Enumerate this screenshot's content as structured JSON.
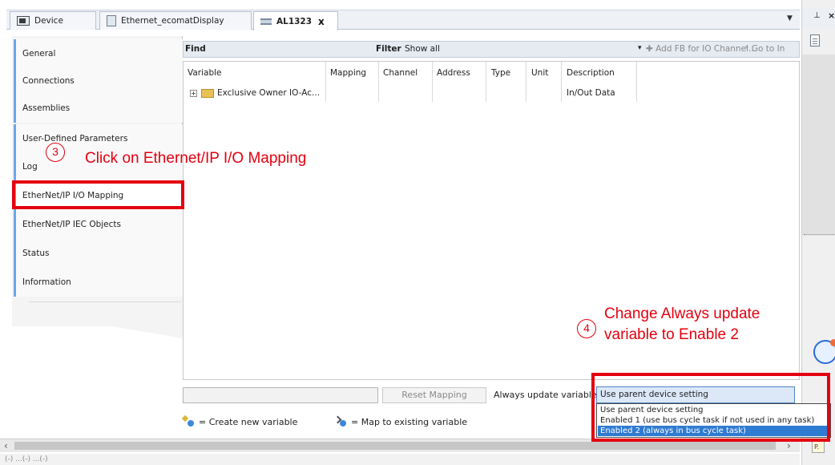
{
  "tabs": [
    {
      "label": "Device",
      "icon": "device-icon"
    },
    {
      "label": "Ethernet_ecomatDisplay",
      "icon": "ethernet-device-icon"
    },
    {
      "label": "AL1323",
      "icon": "module-icon",
      "close": "x"
    }
  ],
  "nav": {
    "items": [
      {
        "label": "General"
      },
      {
        "label": "Connections"
      },
      {
        "label": "Assemblies"
      },
      {
        "label": "User-Defined Parameters"
      },
      {
        "label": "Log"
      },
      {
        "label": "EtherNet/IP I/O Mapping"
      },
      {
        "label": "EtherNet/IP IEC Objects"
      },
      {
        "label": "Status"
      },
      {
        "label": "Information"
      }
    ]
  },
  "findbar": {
    "find_label": "Find",
    "filter_label": "Filter",
    "filter_value": "Show all",
    "add_fb": "Add FB for IO Channel...",
    "goto": "Go to In"
  },
  "table": {
    "headers": [
      "Variable",
      "Mapping",
      "Channel",
      "Address",
      "Type",
      "Unit",
      "Description"
    ],
    "rows": [
      {
        "variable": "Exclusive Owner IO-Ac...",
        "description": "In/Out Data"
      }
    ]
  },
  "bottom": {
    "reset_mapping": "Reset Mapping",
    "always_update_label": "Always update variables",
    "combo_value": "Use parent device setting",
    "options": [
      "Use parent device setting",
      "Enabled 1 (use bus cycle task if not used in any task)",
      "Enabled 2 (always in bus cycle task)"
    ],
    "create_new": "= Create new variable",
    "map_existing": "= Map to existing variable"
  },
  "annotations": {
    "step3_number": "3",
    "step3_text": "Click on Ethernet/IP I/O Mapping",
    "step4_number": "4",
    "step4_line1": "Change Always update",
    "step4_line2": "variable to Enable 2"
  },
  "footer_text": "(-) ...(-) ...(-)",
  "dock_footer": "P.",
  "colors": {
    "annotation_red": "#e4000f",
    "selection_blue": "#2f7bd2",
    "nav_accent": "#6ca5e6"
  }
}
